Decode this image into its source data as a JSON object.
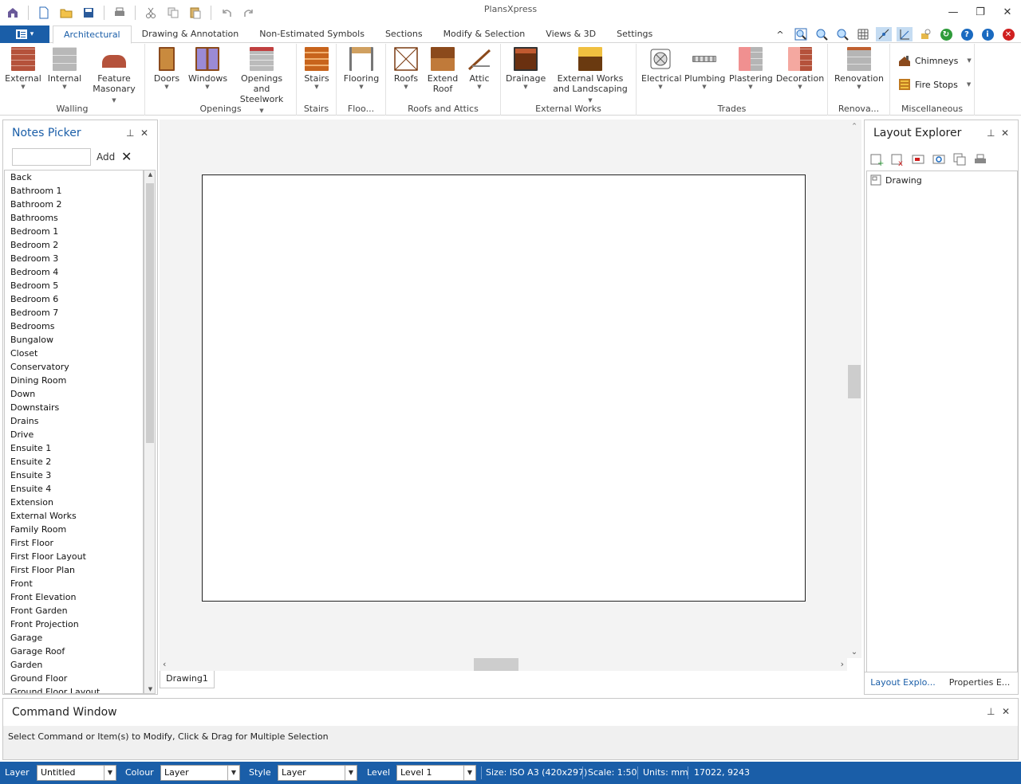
{
  "app": {
    "title": "PlansXpress"
  },
  "ribbon": {
    "tabs": [
      "Architectural",
      "Drawing & Annotation",
      "Non-Estimated Symbols",
      "Sections",
      "Modify & Selection",
      "Views & 3D",
      "Settings"
    ],
    "groups": {
      "walling": {
        "label": "Walling",
        "buttons": [
          "External",
          "Internal",
          "Feature Masonary"
        ]
      },
      "openings": {
        "label": "Openings",
        "buttons": [
          "Doors",
          "Windows",
          "Openings and Steelwork"
        ]
      },
      "stairs": {
        "label": "Stairs",
        "buttons": [
          "Stairs"
        ]
      },
      "flooring": {
        "label": "Floo...",
        "buttons": [
          "Flooring"
        ]
      },
      "roofs": {
        "label": "Roofs and Attics",
        "buttons": [
          "Roofs",
          "Extend Roof",
          "Attic"
        ]
      },
      "external": {
        "label": "External Works",
        "buttons": [
          "Drainage",
          "External Works and Landscaping"
        ]
      },
      "trades": {
        "label": "Trades",
        "buttons": [
          "Electrical",
          "Plumbing",
          "Plastering",
          "Decoration"
        ]
      },
      "renovation": {
        "label": "Renova...",
        "buttons": [
          "Renovation"
        ]
      },
      "misc": {
        "label": "Miscellaneous",
        "buttons": [
          "Chimneys",
          "Fire Stops"
        ]
      }
    }
  },
  "notes_picker": {
    "title": "Notes Picker",
    "search_value": "",
    "add_label": "Add",
    "items": [
      "Back",
      "Bathroom 1",
      "Bathroom 2",
      "Bathrooms",
      "Bedroom 1",
      "Bedroom 2",
      "Bedroom 3",
      "Bedroom 4",
      "Bedroom 5",
      "Bedroom 6",
      "Bedroom 7",
      "Bedrooms",
      "Bungalow",
      "Closet",
      "Conservatory",
      "Dining Room",
      "Down",
      "Downstairs",
      "Drains",
      "Drive",
      "Ensuite 1",
      "Ensuite 2",
      "Ensuite 3",
      "Ensuite 4",
      "Extension",
      "External Works",
      "Family Room",
      "First Floor",
      "First Floor Layout",
      "First Floor Plan",
      "Front",
      "Front Elevation",
      "Front Garden",
      "Front Projection",
      "Garage",
      "Garage Roof",
      "Garden",
      "Ground Floor",
      "Ground Floor Layout"
    ]
  },
  "document_tab": "Drawing1",
  "layout_explorer": {
    "title": "Layout Explorer",
    "tree_item": "Drawing",
    "bottom_tabs": [
      "Layout Explo...",
      "Properties E..."
    ]
  },
  "command_window": {
    "title": "Command Window",
    "message": "Select Command or Item(s) to Modify, Click & Drag for Multiple Selection"
  },
  "status_bar": {
    "layer_label": "Layer",
    "layer_value": "Untitled",
    "colour_label": "Colour",
    "colour_value": "Layer",
    "style_label": "Style",
    "style_value": "Layer",
    "level_label": "Level",
    "level_value": "Level 1",
    "size": "Size: ISO A3 (420x297)",
    "scale": "Scale: 1:50",
    "units": "Units: mm",
    "coords": "17022, 9243"
  },
  "colors": {
    "accent": "#1a5ea8",
    "brick": "#b5523b",
    "wood": "#8b4a1c"
  }
}
